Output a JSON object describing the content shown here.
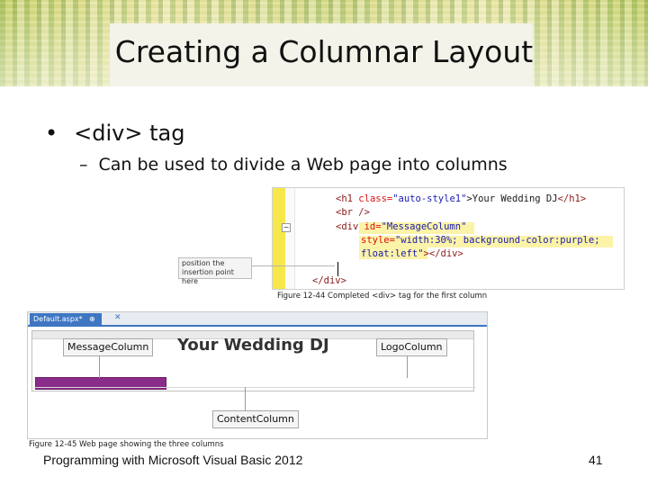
{
  "slide": {
    "title": "Creating a Columnar Layout",
    "bullet": "<div> tag",
    "sub_bullet": "Can be used to divide a Web page into columns",
    "footer": "Programming with Microsoft Visual Basic 2012",
    "page_number": "41"
  },
  "figure_12_44": {
    "caption": "Figure 12-44 Completed <div> tag for the first column",
    "callout": "position the insertion point here",
    "code": {
      "line1_tag_open": "<h1 ",
      "line1_attr": "class=",
      "line1_val": "\"auto-style1\"",
      "line1_text": ">Your Wedding DJ",
      "line1_tag_close": "</h1>",
      "line2": "<br />",
      "line3_tag": "<div ",
      "line3_attr": "id=",
      "line3_val": "\"MessageColumn\"",
      "line4_attr": "style=",
      "line4_val": "\"width:30%; background-color:purple;",
      "line5_val": "float:left\"",
      "line5_tag": "></div>",
      "line6": "</div>"
    }
  },
  "figure_12_45": {
    "caption": "Figure 12-45 Web page showing the three columns",
    "tab_label": "Default.aspx*",
    "tab_close": "⊕ ✕",
    "tab_x": "✕",
    "heading": "Your Wedding DJ",
    "labels": {
      "message_column": "MessageColumn",
      "logo_column": "LogoColumn",
      "content_column": "ContentColumn"
    },
    "colors": {
      "column_fill": "#8a2c8a",
      "tab_accent": "#3e76c2"
    }
  }
}
